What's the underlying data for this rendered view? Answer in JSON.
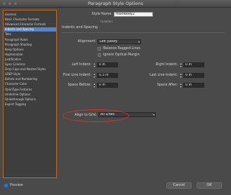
{
  "window": {
    "title": "Paragraph Style Options"
  },
  "sidebar": {
    "items": [
      {
        "label": "General"
      },
      {
        "label": "Basic Character Formats"
      },
      {
        "label": "Advanced Character Formats"
      },
      {
        "label": "Indents and Spacing",
        "selected": true
      },
      {
        "label": "Tabs"
      },
      {
        "label": "Paragraph Rules"
      },
      {
        "label": "Paragraph Shading"
      },
      {
        "label": "Keep Options"
      },
      {
        "label": "Hyphenation"
      },
      {
        "label": "Justification"
      },
      {
        "label": "Span Columns"
      },
      {
        "label": "Drop Caps and Nested Styles"
      },
      {
        "label": "GREP Style"
      },
      {
        "label": "Bullets and Numbering"
      },
      {
        "label": "Character Color"
      },
      {
        "label": "OpenType Features"
      },
      {
        "label": "Underline Options"
      },
      {
        "label": "Strikethrough Options"
      },
      {
        "label": "Export Tagging"
      }
    ]
  },
  "form": {
    "style_name_label": "Style Name:",
    "style_name_value": "mainbody2",
    "location_label": "Location:",
    "section_title": "Indents and Spacing",
    "alignment_label": "Alignment:",
    "alignment_value": "Left Justify",
    "balance_label": "Balance Ragged Lines",
    "ignore_label": "Ignore Optical Margin",
    "left_indent_label": "Left Indent:",
    "left_indent_value": "0 in",
    "right_indent_label": "Right Indent:",
    "right_indent_value": "0 in",
    "first_line_label": "First Line Indent:",
    "first_line_value": "0.3 in",
    "last_line_label": "Last Line Indent:",
    "last_line_value": "0 in",
    "space_before_label": "Space Before:",
    "space_before_value": "0 in",
    "space_after_label": "Space After:",
    "space_after_value": "0 in",
    "align_grid_label": "Align to Grid:",
    "align_grid_value": "All Lines"
  },
  "footer": {
    "preview_label": "Preview",
    "cancel_label": "Cancel",
    "ok_label": "OK"
  },
  "colors": {
    "highlight": "#d9302a",
    "selection": "#5a85c4",
    "sidebar_border": "#c06a28"
  }
}
